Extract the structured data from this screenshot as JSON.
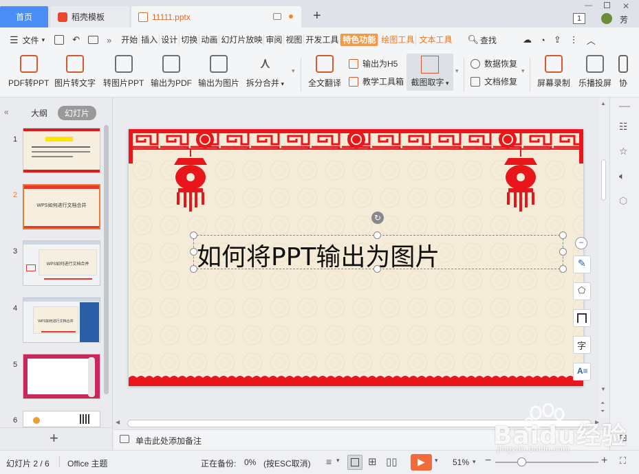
{
  "tabs": {
    "home": "首页",
    "template": "稻壳模板",
    "document": "11111.pptx"
  },
  "window": {
    "badge": "1",
    "user": "芳"
  },
  "menu": {
    "file": "文件",
    "items": [
      "开始",
      "插入",
      "设计",
      "切换",
      "动画",
      "幻灯片放映",
      "审阅",
      "视图",
      "开发工具"
    ],
    "active": "特色功能",
    "orange_items": [
      "绘图工具",
      "文本工具"
    ],
    "search": "查找"
  },
  "ribbon": {
    "pdf2ppt": "PDF转PPT",
    "img2text": "图片转文字",
    "img2ppt": "转图片PPT",
    "to_pdf": "输出为PDF",
    "to_img": "输出为图片",
    "split_merge": "拆分合并",
    "translate": "全文翻译",
    "to_h5": "输出为H5",
    "teach_box": "教学工具箱",
    "screenshot_ocr": "截图取字",
    "data_recovery": "数据恢复",
    "doc_repair": "文档修复",
    "screen_record": "屏幕录制",
    "cast": "乐播投屏",
    "collab": "协"
  },
  "panel": {
    "outline_tab": "大纲",
    "slides_tab": "幻灯片",
    "thumbs": [
      {
        "num": "1"
      },
      {
        "num": "2",
        "text": "WPS如何进行文档合并"
      },
      {
        "num": "3",
        "text": "WPS如何进行文档合并"
      },
      {
        "num": "4",
        "text": "WPS如何进行文档合并"
      },
      {
        "num": "5"
      },
      {
        "num": "6"
      }
    ]
  },
  "slide": {
    "title": "如何将PPT输出为图片"
  },
  "notes": {
    "placeholder": "单击此处添加备注"
  },
  "status": {
    "slide_index": "幻灯片 2 / 6",
    "theme": "Office 主题",
    "backup": "正在备份:",
    "backup_pct": "0%",
    "backup_hint": "(按ESC取消)",
    "zoom": "51%"
  },
  "colors": {
    "accent_blue": "#4a8ef5",
    "accent_orange": "#f29a4a",
    "slide_red": "#e8151b"
  },
  "watermark": {
    "brand": "Baidu经验",
    "url": "jingyan.baidu.com"
  }
}
